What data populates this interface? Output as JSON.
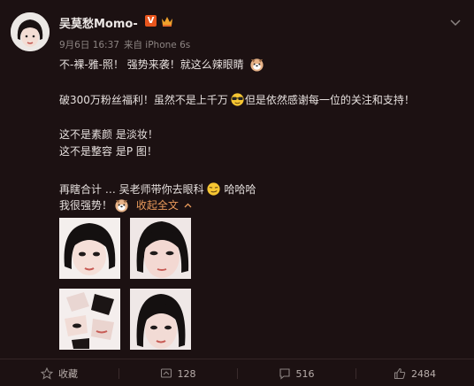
{
  "user": {
    "name": "吴莫愁Momo-",
    "badge_letter": "V",
    "time": "9月6日 16:37",
    "source": "来自 iPhone 6s"
  },
  "post": {
    "line1": "不-裸-雅-照！ 强势来袭！就这么辣眼睛",
    "line2a": "破300万粉丝福利！虽然不是上千万",
    "line2b": "但是依然感谢每一位的关注和支持！",
    "line3": "这不是素颜 是淡妆！",
    "line4": "这不是整容 是P 图！",
    "line5a": "再瞎合计 … 吴老师带你去眼科",
    "line5b": "哈哈哈",
    "line6": "我很强势！",
    "collapse_label": "收起全文"
  },
  "emoji": [
    "husky-emoji",
    "cool-sunglasses-emoji",
    "smirk-emoji",
    "husky-emoji"
  ],
  "actions": {
    "favorite_label": "收藏",
    "repost_count": "128",
    "comment_count": "516",
    "like_count": "2484"
  },
  "colors": {
    "background": "#1c1112",
    "link": "#e99a5b",
    "badge": "#e8551d"
  }
}
